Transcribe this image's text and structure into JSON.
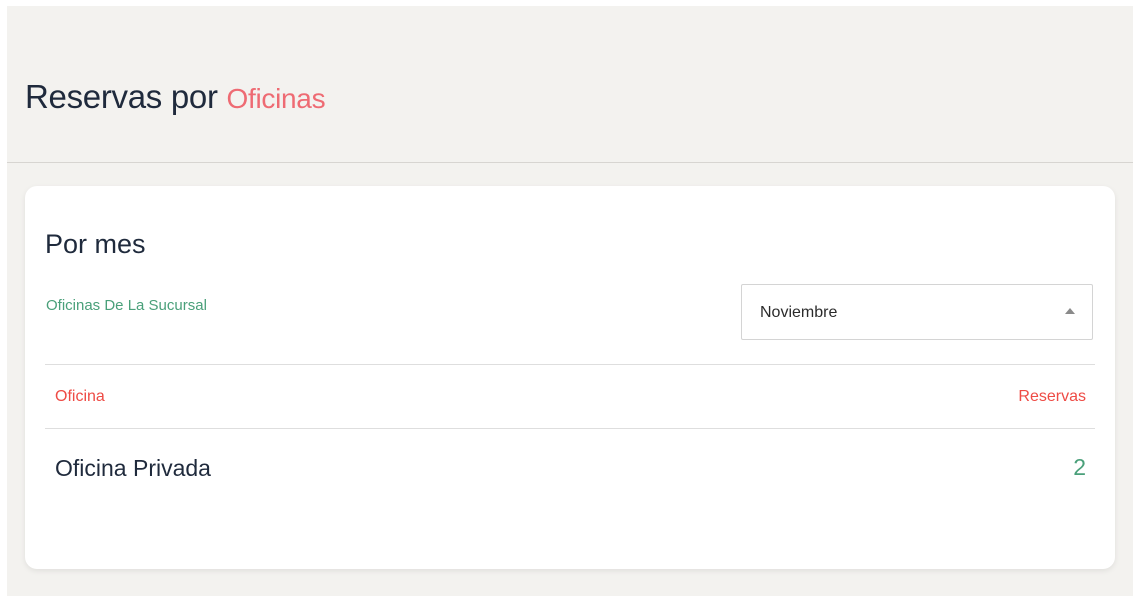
{
  "header": {
    "title_prefix": "Reservas por",
    "title_accent": "Oficinas"
  },
  "card": {
    "title": "Por mes",
    "subtitle": "Oficinas De La Sucursal",
    "month_select": {
      "selected": "Noviembre",
      "caret_icon": "caret-up-icon"
    },
    "table": {
      "columns": [
        "Oficina",
        "Reservas"
      ],
      "rows": [
        {
          "oficina": "Oficina Privada",
          "reservas": "2"
        }
      ]
    }
  },
  "colors": {
    "background": "#f3f2ef",
    "title_dark": "#1f2a3c",
    "accent_pink": "#ee6b73",
    "header_red": "#ee4b45",
    "green": "#4aa07a"
  }
}
